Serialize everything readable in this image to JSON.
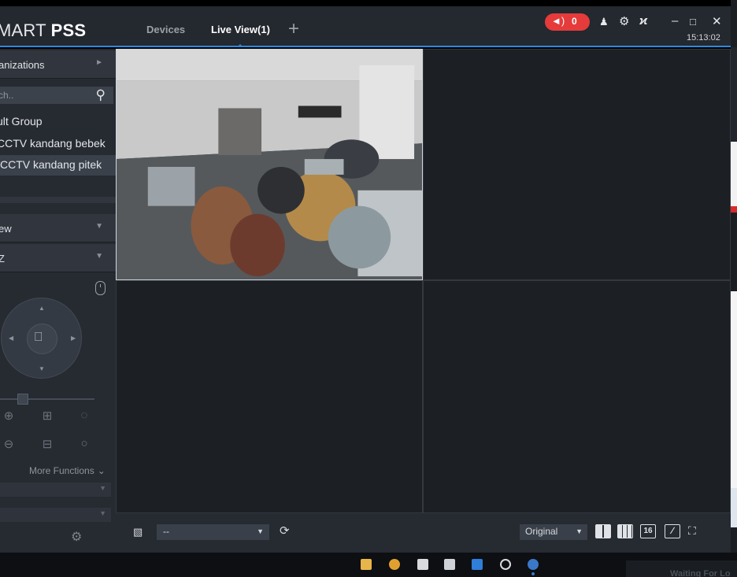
{
  "app": {
    "title_light": "MART",
    "title_bold": "PSS"
  },
  "tabs": [
    {
      "label": "Devices",
      "active": false
    },
    {
      "label": "Live View(1)",
      "active": true
    }
  ],
  "tab_add": "+",
  "alarm": {
    "count": "0",
    "color": "#e53b3b"
  },
  "titlebar_icons": [
    "user-icon",
    "settings-icon",
    "performance-icon",
    "minimize-icon",
    "maximize-icon",
    "close-icon"
  ],
  "clock": "15:13:02",
  "sidebar": {
    "organizations_label": "anizations",
    "search_placeholder": "ch..",
    "tree": [
      {
        "label": "ult Group",
        "selected": false
      },
      {
        "label": "CCTV kandang bebek",
        "selected": false
      },
      {
        "label": "CCTV kandang pitek",
        "selected": true
      }
    ],
    "view_label": "ew",
    "ptz_label": "Z",
    "more_functions": "More Functions"
  },
  "bottombar": {
    "stream_value": "--",
    "ratio_value": "Original",
    "layout_16_label": "16"
  },
  "taskbar": {
    "waiting_text": "Waiting For Lo"
  },
  "colors": {
    "accent": "#2c8ae0",
    "background": "#1d2126",
    "panel": "#262a31"
  }
}
